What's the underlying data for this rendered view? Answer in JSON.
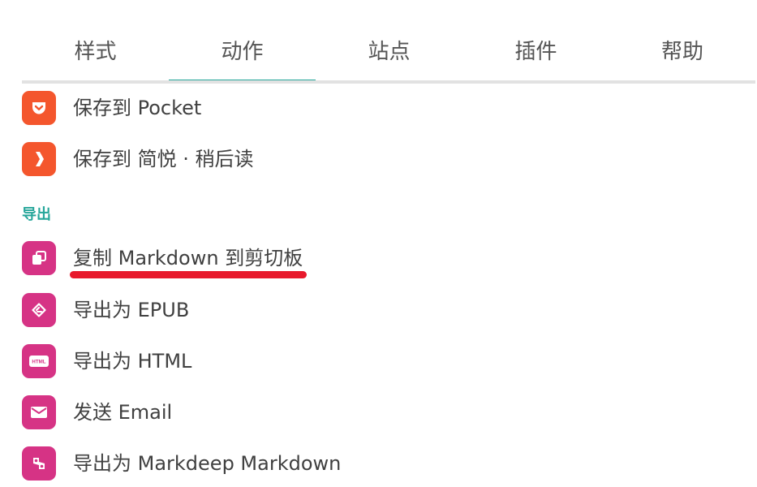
{
  "tabs": [
    {
      "label": "样式",
      "active": false
    },
    {
      "label": "动作",
      "active": true
    },
    {
      "label": "站点",
      "active": false
    },
    {
      "label": "插件",
      "active": false
    },
    {
      "label": "帮助",
      "active": false
    }
  ],
  "colors": {
    "accent": "#26a69a",
    "pocket_orange": "#f4562d",
    "export_magenta": "#d63385",
    "highlight_red": "#e8192c"
  },
  "save_items": [
    {
      "label": "保存到 Pocket",
      "icon": "pocket-icon"
    },
    {
      "label": "保存到 简悦 · 稍后读",
      "icon": "read-later-chevron-icon"
    }
  ],
  "export_section": {
    "title": "导出",
    "items": [
      {
        "label": "复制 Markdown 到剪切板",
        "icon": "copy-icon",
        "highlighted": true
      },
      {
        "label": "导出为 EPUB",
        "icon": "epub-icon"
      },
      {
        "label": "导出为 HTML",
        "icon": "html-icon",
        "icon_text": "HTML"
      },
      {
        "label": "发送 Email",
        "icon": "email-icon"
      },
      {
        "label": "导出为 Markdeep Markdown",
        "icon": "markdeep-icon"
      }
    ]
  }
}
